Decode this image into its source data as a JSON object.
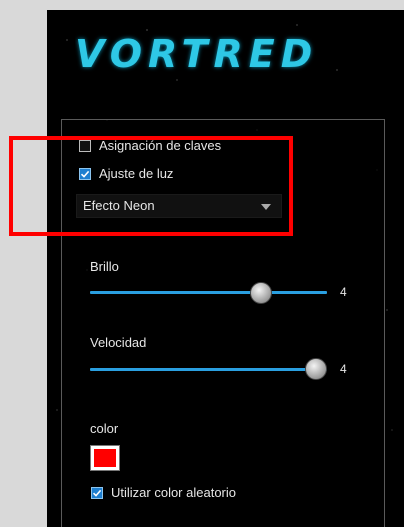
{
  "logo": {
    "text": "VORTRED"
  },
  "options": {
    "key_assignment": {
      "label": "Asignación de claves",
      "checked": false
    },
    "light_adjust": {
      "label": "Ajuste de luz",
      "checked": true
    },
    "effect_select": {
      "value": "Efecto Neon"
    }
  },
  "brightness": {
    "label": "Brillo",
    "value": "4",
    "level": 4,
    "max": 5
  },
  "speed": {
    "label": "Velocidad",
    "value": "4",
    "level": 4,
    "max": 4
  },
  "color": {
    "label": "color",
    "swatch": "#ff0000"
  },
  "random_color": {
    "label": "Utilizar color aleatorio",
    "checked": true
  },
  "colors": {
    "accent": "#2a9fe0",
    "logo": "#2ec8e6",
    "highlight": "#ff0000"
  }
}
